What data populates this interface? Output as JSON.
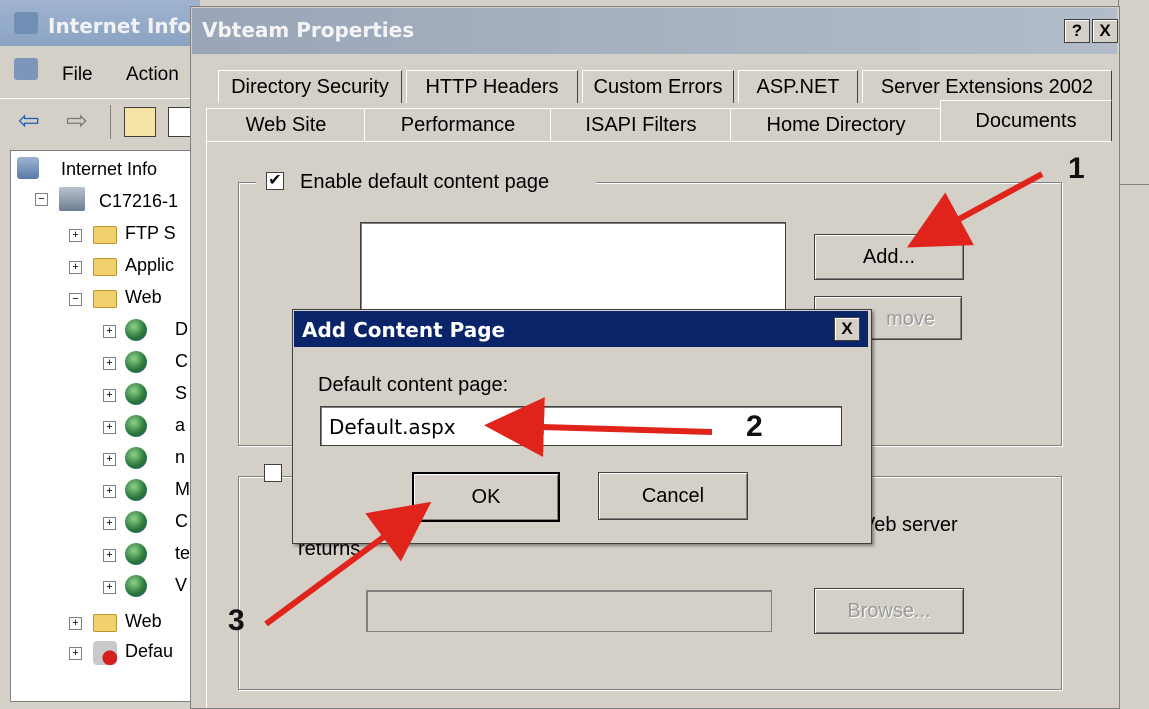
{
  "bg_window": {
    "title": "Internet Info",
    "menu": [
      "File",
      "Action"
    ],
    "tree": {
      "root": "Internet Info",
      "server": "C17216-1",
      "folders": [
        "FTP S",
        "Applic",
        "Web"
      ],
      "sites": [
        "D",
        "C",
        "S",
        "a",
        "n",
        "M",
        "C",
        "te",
        "V"
      ],
      "bottom": [
        "Web",
        "Defau"
      ]
    }
  },
  "properties_dialog": {
    "title": "Vbteam Properties",
    "help_button": "?",
    "close_button": "X",
    "tabs_row1": [
      "Directory Security",
      "HTTP Headers",
      "Custom Errors",
      "ASP.NET",
      "Server Extensions 2002"
    ],
    "tabs_row2": [
      "Web Site",
      "Performance",
      "ISAPI Filters",
      "Home Directory",
      "Documents"
    ],
    "active_tab": "Documents",
    "enable_default": {
      "label": "Enable default content page",
      "checked": true
    },
    "add_button": "Add...",
    "remove_button_visible": "move",
    "footer_text_right": "Veb server",
    "footer_text_left": "returns",
    "browse_button": "Browse..."
  },
  "add_dialog": {
    "title": "Add Content Page",
    "close": "X",
    "field_label": "Default content page:",
    "field_value": "Default.aspx",
    "ok_button": "OK",
    "cancel_button": "Cancel"
  },
  "annotations": [
    "1",
    "2",
    "3"
  ],
  "colors": {
    "arrow": "#e0241b",
    "title_active": "#0a246a"
  }
}
